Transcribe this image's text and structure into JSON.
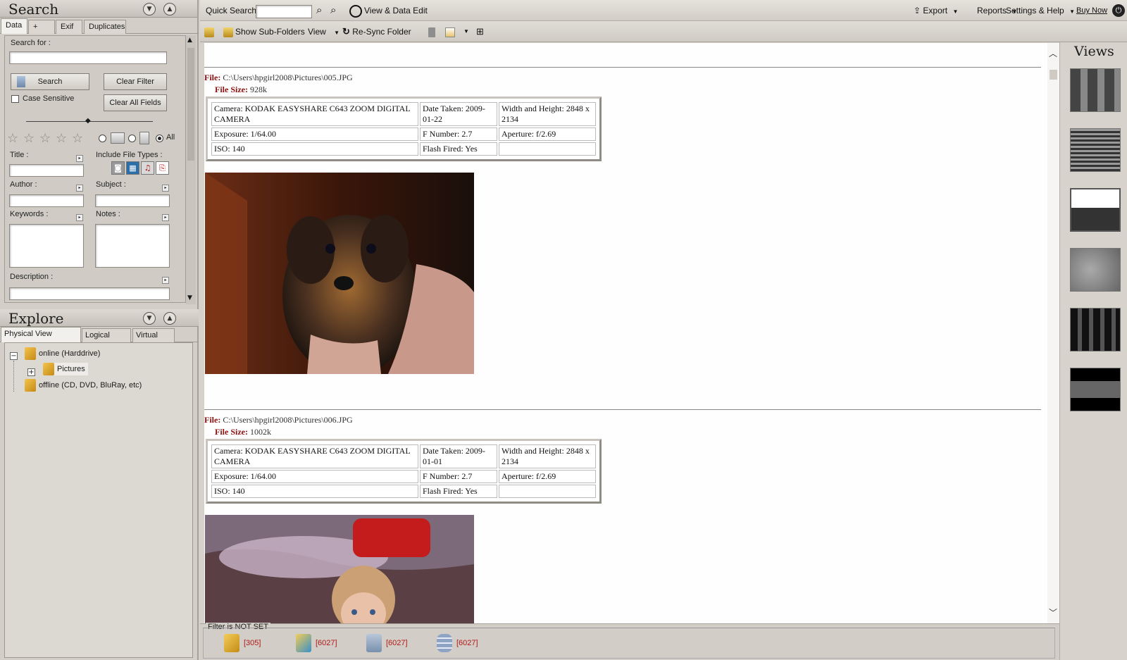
{
  "search_panel": {
    "title": "Search",
    "tabs": [
      "Data",
      "+",
      "Exif",
      "Duplicates"
    ],
    "search_for_label": "Search for :",
    "search_button": "Search",
    "clear_filter_button": "Clear Filter",
    "clear_all_button": "Clear All Fields",
    "case_sensitive_label": "Case Sensitive",
    "radio_all_label": "All",
    "title_label": "Title :",
    "include_file_types_label": "Include File Types :",
    "author_label": "Author :",
    "subject_label": "Subject :",
    "keywords_label": "Keywords :",
    "notes_label": "Notes :",
    "description_label": "Description :"
  },
  "explore_panel": {
    "title": "Explore",
    "tabs": [
      "Physical View (Folders)",
      "Logical Views",
      "Virtual Set"
    ],
    "tree": {
      "online": "online (Harddrive)",
      "pictures": "Pictures",
      "offline": "offline (CD, DVD, BluRay, etc)"
    }
  },
  "topbar": {
    "quick_search_label": "Quick Search:",
    "view_data_edit": "View & Data Edit",
    "export": "Export",
    "reports": "Reports",
    "settings_help": "Settings & Help",
    "buy_now": "Buy Now"
  },
  "toolbar2": {
    "show_subfolders": "Show Sub-Folders",
    "view": "View",
    "resync": "Re-Sync Folder"
  },
  "records": [
    {
      "file_label": "File:",
      "file_path": "C:\\Users\\hpgirl2008\\Pictures\\005.JPG",
      "size_label": "File Size:",
      "file_size": "928k",
      "camera": "Camera: KODAK EASYSHARE C643 ZOOM DIGITAL CAMERA",
      "date_taken": "Date Taken: 2009-01-22",
      "dimensions": "Width and Height: 2848 x 2134",
      "exposure": "Exposure: 1/64.00",
      "f_number": "F Number: 2.7",
      "aperture": "Aperture: f/2.69",
      "iso": "ISO: 140",
      "flash": "Flash Fired: Yes"
    },
    {
      "file_label": "File:",
      "file_path": "C:\\Users\\hpgirl2008\\Pictures\\006.JPG",
      "size_label": "File Size:",
      "file_size": "1002k",
      "camera": "Camera: KODAK EASYSHARE C643 ZOOM DIGITAL CAMERA",
      "date_taken": "Date Taken: 2009-01-01",
      "dimensions": "Width and Height: 2848 x 2134",
      "exposure": "Exposure: 1/64.00",
      "f_number": "F Number: 2.7",
      "aperture": "Aperture: f/2.69",
      "iso": "ISO: 140",
      "flash": "Flash Fired: Yes"
    }
  ],
  "views_panel": {
    "title": "Views"
  },
  "status": {
    "filter_text": "Filter is NOT SET",
    "counts": [
      "[305]",
      "[6027]",
      "[6027]",
      "[6027]"
    ]
  },
  "colors": {
    "file_label": "#8b1010",
    "status_count": "#b11818",
    "panel_bg": "#d3cfc8"
  }
}
